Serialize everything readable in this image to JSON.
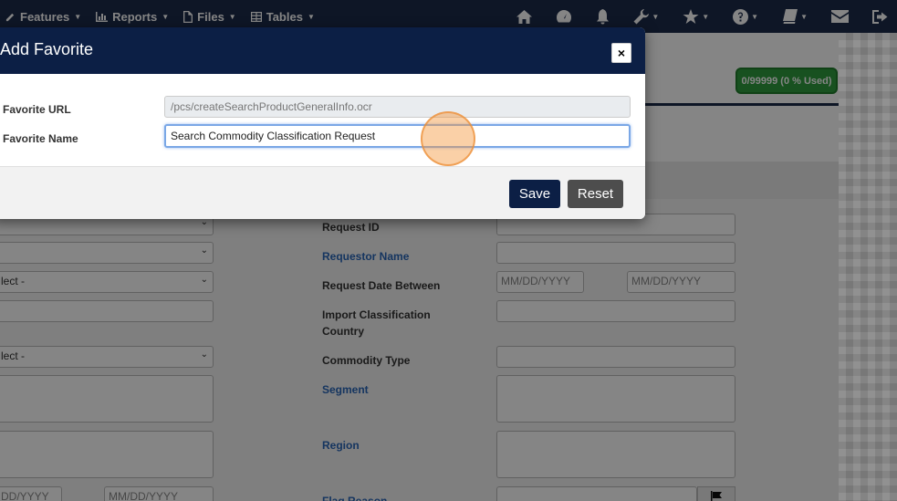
{
  "navbar": {
    "items": [
      {
        "label": "Features"
      },
      {
        "label": "Reports"
      },
      {
        "label": "Files"
      },
      {
        "label": "Tables"
      }
    ],
    "right_icons": [
      "home-icon",
      "dashboard-icon",
      "bell-icon",
      "wrench-icon",
      "star-icon",
      "question-icon",
      "book-icon",
      "envelope-icon",
      "logout-icon"
    ]
  },
  "page": {
    "usage_badge": "0/99999 (0 % Used)",
    "left_selects": [
      "",
      "",
      "lect -",
      "",
      "lect -"
    ],
    "left_dates": [
      "DD/YYYY",
      "MM/DD/YYYY"
    ],
    "fields": [
      {
        "label": "Request ID"
      },
      {
        "label": "Requestor Name"
      },
      {
        "label": "Request Date Between",
        "placeholder_from": "MM/DD/YYYY",
        "placeholder_to": "MM/DD/YYYY"
      },
      {
        "label": "Import Classification Country"
      },
      {
        "label": "Commodity Type"
      },
      {
        "label": "Segment"
      },
      {
        "label": "Region"
      },
      {
        "label": "Flag Reason"
      }
    ]
  },
  "modal": {
    "title": "Add Favorite",
    "close_label": "×",
    "url_label": "Favorite URL",
    "url_value": "/pcs/createSearchProductGeneralInfo.ocr",
    "name_label": "Favorite Name",
    "name_value": "Search Commodity Classification Request",
    "save_label": "Save",
    "reset_label": "Reset"
  }
}
